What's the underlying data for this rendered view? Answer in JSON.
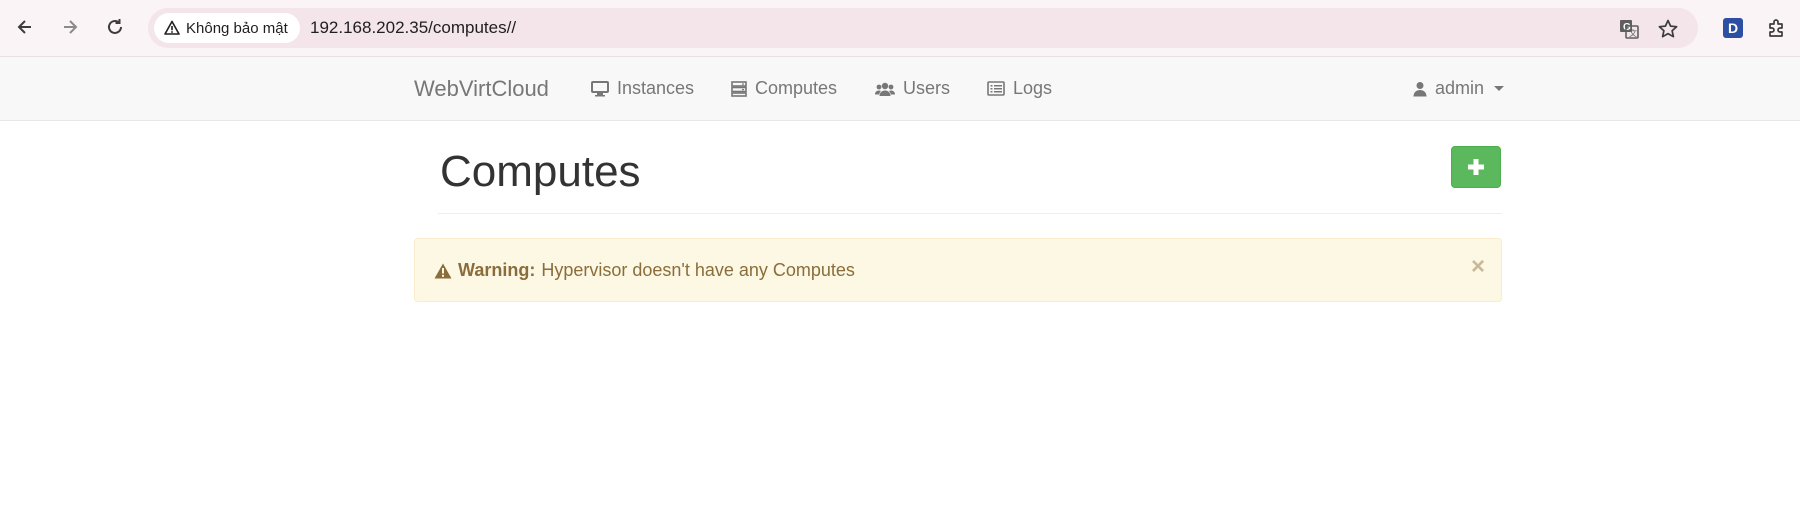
{
  "browser": {
    "security_label": "Không bảo mật",
    "url": "192.168.202.35/computes//",
    "extension_badge": "D"
  },
  "navbar": {
    "brand": "WebVirtCloud",
    "items": [
      {
        "label": "Instances",
        "icon": "desktop-icon"
      },
      {
        "label": "Computes",
        "icon": "server-icon"
      },
      {
        "label": "Users",
        "icon": "users-icon"
      },
      {
        "label": "Logs",
        "icon": "list-icon"
      }
    ],
    "user": "admin"
  },
  "main": {
    "title": "Computes",
    "add_button_icon": "plus-icon",
    "alert": {
      "strong": "Warning:",
      "message": "Hypervisor doesn't have any Computes",
      "close": "×"
    }
  },
  "colors": {
    "success": "#5cb85c",
    "warning_bg": "#fcf8e3",
    "warning_text": "#8a6d3b"
  }
}
